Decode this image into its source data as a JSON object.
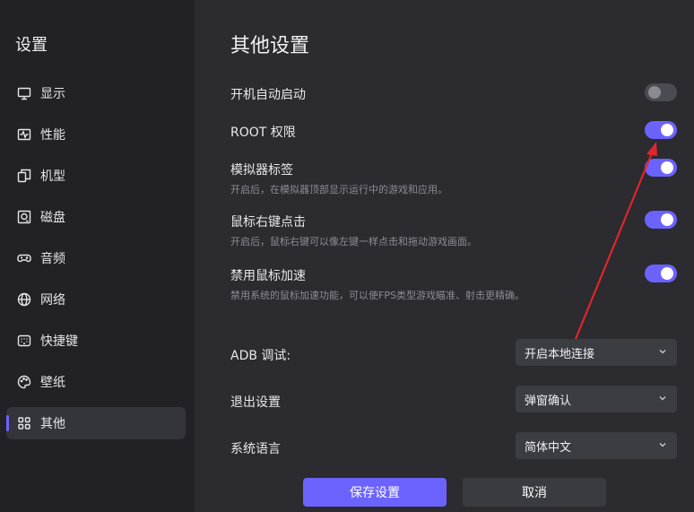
{
  "sidebar": {
    "title": "设置",
    "items": [
      {
        "label": "显示",
        "icon": "monitor-icon"
      },
      {
        "label": "性能",
        "icon": "activity-icon"
      },
      {
        "label": "机型",
        "icon": "devices-icon"
      },
      {
        "label": "磁盘",
        "icon": "disk-icon"
      },
      {
        "label": "音频",
        "icon": "gamepad-icon"
      },
      {
        "label": "网络",
        "icon": "globe-icon"
      },
      {
        "label": "快捷键",
        "icon": "keyboard-icon"
      },
      {
        "label": "壁纸",
        "icon": "palette-icon"
      },
      {
        "label": "其他",
        "icon": "grid-icon",
        "active": true
      }
    ]
  },
  "main": {
    "title": "其他设置",
    "toggles": [
      {
        "label": "开机自动启动",
        "desc": "",
        "on": false
      },
      {
        "label": "ROOT 权限",
        "desc": "",
        "on": true
      },
      {
        "label": "模拟器标签",
        "desc": "开启后，在模拟器顶部显示运行中的游戏和应用。",
        "on": true
      },
      {
        "label": "鼠标右键点击",
        "desc": "开启后，鼠标右键可以像左键一样点击和拖动游戏画面。",
        "on": true
      },
      {
        "label": "禁用鼠标加速",
        "desc": "禁用系统的鼠标加速功能，可以使FPS类型游戏瞄准、射击更精确。",
        "on": true
      }
    ],
    "selects": [
      {
        "label": "ADB 调试:",
        "value": "开启本地连接"
      },
      {
        "label": "退出设置",
        "value": "弹窗确认"
      },
      {
        "label": "系统语言",
        "value": "简体中文"
      }
    ],
    "save_label": "保存设置",
    "cancel_label": "取消"
  },
  "colors": {
    "accent": "#6c63ff",
    "annotation_arrow": "#e0262b"
  }
}
